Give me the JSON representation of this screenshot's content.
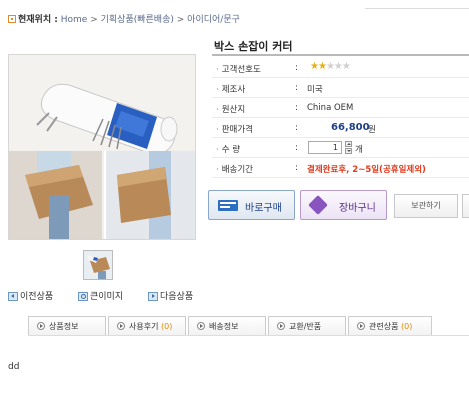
{
  "breadcrumb": {
    "here_label": "현재위치 :",
    "items": [
      "Home",
      "기획상품(빠른배송)",
      "아이디어/문구"
    ],
    "separator": ">"
  },
  "product": {
    "title": "박스 손잡이 커터",
    "specs": {
      "rating": {
        "label": "고객선호도",
        "colon": ":",
        "stars_filled": 2,
        "stars_total": 5,
        "star_color": "#e6b010"
      },
      "maker": {
        "label": "제조사",
        "colon": ":",
        "value": "미국"
      },
      "origin": {
        "label": "원산지",
        "colon": ":",
        "value": "China OEM"
      },
      "price": {
        "label": "판매가격",
        "colon": ":",
        "value": "66,800",
        "unit": "원",
        "color": "#1d3f8a"
      },
      "quantity": {
        "label": "수  량",
        "colon": ":",
        "value": "1",
        "unit": "개"
      },
      "shipping": {
        "label": "배송기간",
        "colon": ":",
        "value": "결제완료후, 2~5일(공휴일제외)",
        "color": "#e03a1b"
      }
    }
  },
  "actions": {
    "buy_now": "바로구매",
    "cart": "장바구니",
    "save": "보관하기"
  },
  "image_nav": {
    "prev": "이전상품",
    "zoom": "큰이미지",
    "next": "다음상품"
  },
  "tabs": [
    {
      "label": "상품정보",
      "count": ""
    },
    {
      "label": "사용후기",
      "count": "(0)"
    },
    {
      "label": "배송정보",
      "count": ""
    },
    {
      "label": "교환/반품",
      "count": ""
    },
    {
      "label": "관련상품",
      "count": "(0)"
    }
  ],
  "content": {
    "body_text": "dd"
  }
}
